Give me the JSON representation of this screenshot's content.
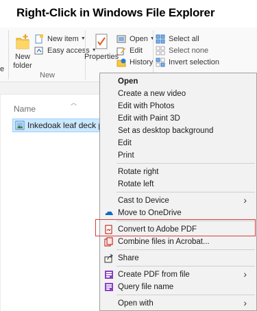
{
  "title": "Right-Click in Windows File Explorer",
  "ribbon": {
    "edge_label_1": "e",
    "new_folder_label_1": "New",
    "new_folder_label_2": "folder",
    "new_item_label": "New item",
    "easy_access_label": "Easy access",
    "group_new_label": "New",
    "properties_label": "Properties",
    "open_label": "Open",
    "edit_label": "Edit",
    "history_label": "History",
    "select_all_label": "Select all",
    "select_none_label": "Select none",
    "invert_selection_label": "Invert selection"
  },
  "file_list": {
    "column_name": "Name",
    "selected_file": "Inkedoak leaf deck pano"
  },
  "context_menu": {
    "items": [
      {
        "label": "Open"
      },
      {
        "label": "Create a new video"
      },
      {
        "label": "Edit with Photos"
      },
      {
        "label": "Edit with Paint 3D"
      },
      {
        "label": "Set as desktop background"
      },
      {
        "label": "Edit"
      },
      {
        "label": "Print"
      },
      {
        "label": "Rotate right"
      },
      {
        "label": "Rotate left"
      },
      {
        "label": "Cast to Device"
      },
      {
        "label": "Move to OneDrive"
      },
      {
        "label": "Convert to Adobe PDF"
      },
      {
        "label": "Combine files in Acrobat..."
      },
      {
        "label": "Share"
      },
      {
        "label": "Create PDF from file"
      },
      {
        "label": "Query file name"
      },
      {
        "label": "Open with"
      }
    ]
  },
  "colors": {
    "highlight_box": "#d83b3b",
    "selection_fill": "#cce8ff",
    "menu_bg": "#f2f2f2"
  }
}
